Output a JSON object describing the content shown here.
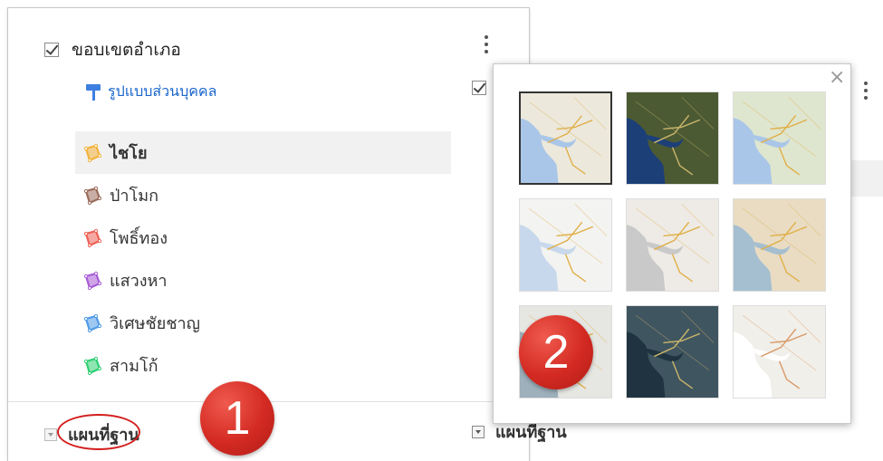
{
  "layer": {
    "title": "ขอบเขตอำเภอ",
    "checked": true,
    "style_link": "รูปแบบส่วนบุคคล",
    "items": [
      {
        "label": "ไชโย",
        "color": "#f3b23b",
        "selected": true
      },
      {
        "label": "ป่าโมก",
        "color": "#9b6b5a",
        "selected": false
      },
      {
        "label": "โพธิ์ทอง",
        "color": "#ee6055",
        "selected": false
      },
      {
        "label": "แสวงหา",
        "color": "#a85bd6",
        "selected": false
      },
      {
        "label": "วิเศษชัยชาญ",
        "color": "#4f9be8",
        "selected": false
      },
      {
        "label": "สามโก้",
        "color": "#2fcf72",
        "selected": false
      }
    ]
  },
  "basemap": {
    "label": "แผนที่ฐาน"
  },
  "background_panel": {
    "basemap_label": "แผนที่ฐาน"
  },
  "annotations": {
    "badge1": "1",
    "badge2": "2",
    "badge_color": "#d32a22"
  },
  "popup": {
    "close_icon": "×",
    "thumbnails": [
      {
        "style": "map",
        "selected": true,
        "land": "#ece8dc",
        "water": "#a9c6e8"
      },
      {
        "style": "satellite",
        "selected": false,
        "land": "#4b5a33",
        "water": "#1d3f78"
      },
      {
        "style": "terrain",
        "selected": false,
        "land": "#dfe6cf",
        "water": "#a9c6e8"
      },
      {
        "style": "light-political",
        "selected": false,
        "land": "#f3f3f1",
        "water": "#c8d8ec"
      },
      {
        "style": "mono-city",
        "selected": false,
        "land": "#eeebe6",
        "water": "#c9c9c9"
      },
      {
        "style": "simple-atlas",
        "selected": false,
        "land": "#e9dcc3",
        "water": "#a5bfd0"
      },
      {
        "style": "light-landmass",
        "selected": false,
        "land": "#e6e6e2",
        "water": "#9db0bb"
      },
      {
        "style": "dark-landmass",
        "selected": false,
        "land": "#3f5560",
        "water": "#1f3440"
      },
      {
        "style": "whitewater",
        "selected": false,
        "land": "#f1efea",
        "water": "#ffffff"
      }
    ]
  }
}
